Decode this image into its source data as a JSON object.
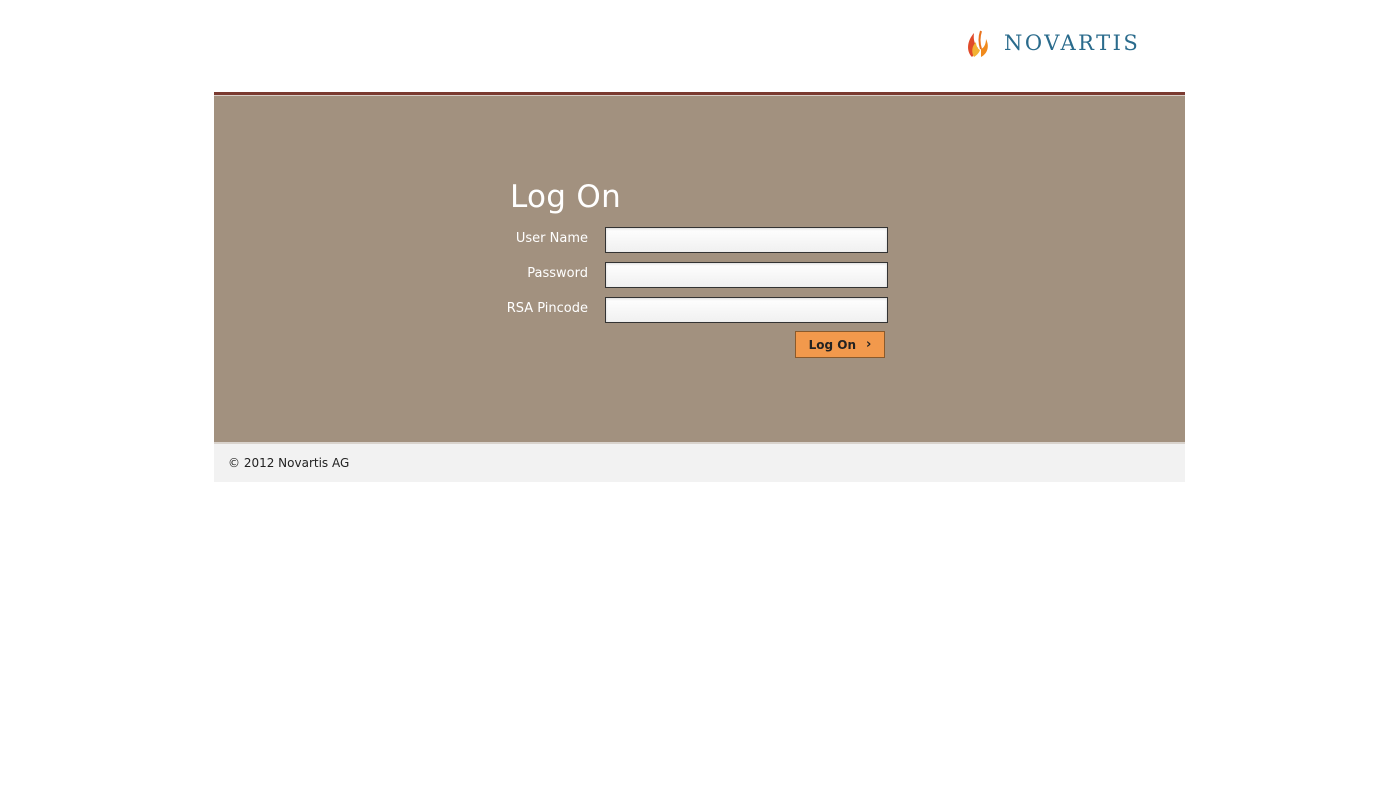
{
  "header": {
    "logo_text": "NOVARTIS"
  },
  "login": {
    "title": "Log On",
    "fields": [
      {
        "label": "User Name",
        "value": ""
      },
      {
        "label": "Password",
        "value": ""
      },
      {
        "label": "RSA Pincode",
        "value": ""
      }
    ],
    "button_label": "Log On",
    "button_icon": "chevron-right-icon"
  },
  "footer": {
    "copyright": "© 2012 Novartis AG"
  },
  "colors": {
    "panel": "#a2917f",
    "accent_rule": "#7a3a30",
    "button": "#f2994c",
    "logo_text": "#2a6b8c"
  }
}
